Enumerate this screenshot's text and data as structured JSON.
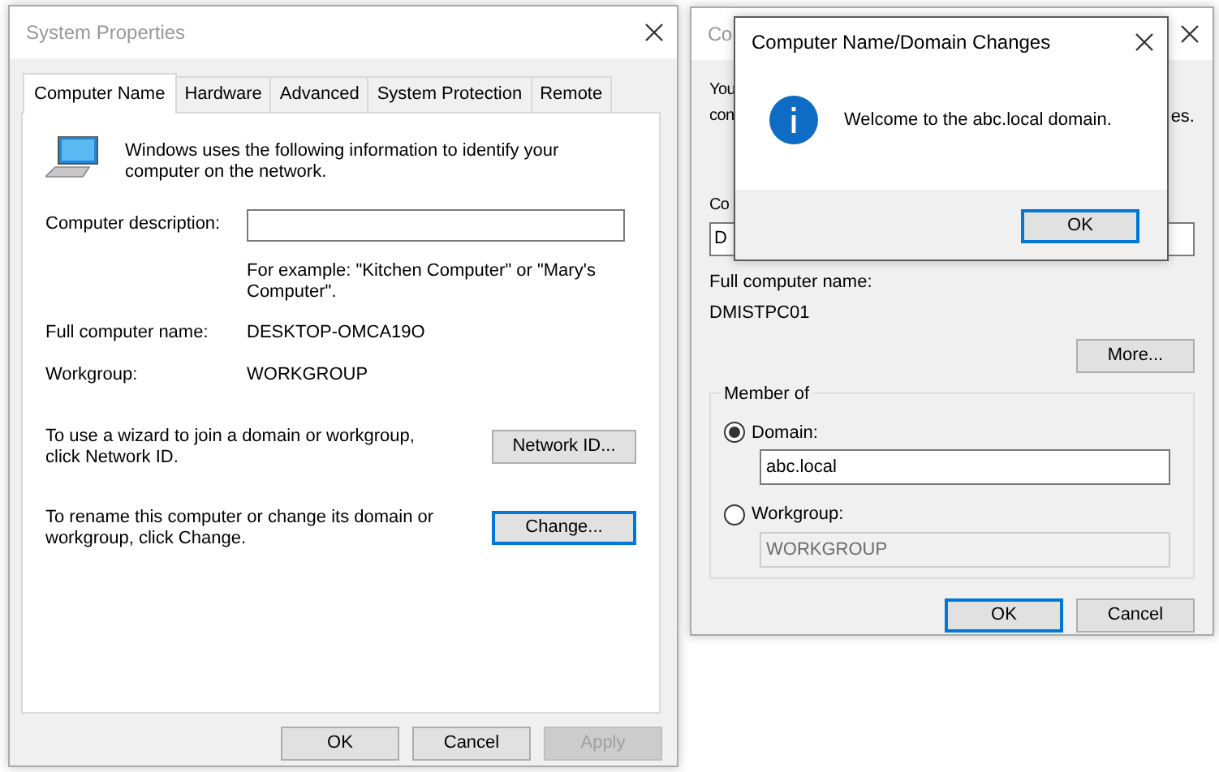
{
  "system_properties": {
    "title": "System Properties",
    "active": false,
    "tabs": [
      {
        "label": "Computer Name",
        "selected": true
      },
      {
        "label": "Hardware",
        "selected": false
      },
      {
        "label": "Advanced",
        "selected": false
      },
      {
        "label": "System Protection",
        "selected": false
      },
      {
        "label": "Remote",
        "selected": false
      }
    ],
    "intro": "Windows uses the following information to identify your computer on the network.",
    "description_label": "Computer description:",
    "description_hint": "For example: \"Kitchen Computer\" or \"Mary's Computer\".",
    "full_name_label": "Full computer name:",
    "full_name_value": "DESKTOP-OMCA19O",
    "workgroup_label": "Workgroup:",
    "workgroup_value": "WORKGROUP",
    "actions": [
      {
        "text": "To use a wizard to join a domain or workgroup, click Network ID.",
        "button": "Network ID...",
        "focused": false
      },
      {
        "text": "To rename this computer or change its domain or workgroup, click Change.",
        "button": "Change...",
        "focused": true
      }
    ],
    "buttons": [
      {
        "label": "OK",
        "disabled": false,
        "focused": false
      },
      {
        "label": "Cancel",
        "disabled": false,
        "focused": false
      },
      {
        "label": "Apply",
        "disabled": true,
        "focused": false
      }
    ]
  },
  "name_changes_window": {
    "title": "Co",
    "active": false,
    "intro_line_1": "You",
    "intro_line_2": "con",
    "intro_tail": "es.",
    "computer_name_label": "Co",
    "computer_name_value": "D",
    "full_name_label": "Full computer name:",
    "full_name_value": "DMISTPC01",
    "more_button": "More...",
    "member_of": "Member of",
    "options": [
      {
        "label": "Domain:",
        "selected": true,
        "value": "abc.local",
        "disabled": false
      },
      {
        "label": "Workgroup:",
        "selected": false,
        "value": "WORKGROUP",
        "disabled": true
      }
    ],
    "buttons": [
      {
        "label": "OK",
        "disabled": false,
        "focused": true
      },
      {
        "label": "Cancel",
        "disabled": false,
        "focused": false
      }
    ]
  },
  "message_dialog": {
    "title": "Computer Name/Domain Changes",
    "active": true,
    "message": "Welcome to the abc.local domain.",
    "buttons": [
      {
        "label": "OK",
        "disabled": false,
        "focused": true
      }
    ]
  }
}
